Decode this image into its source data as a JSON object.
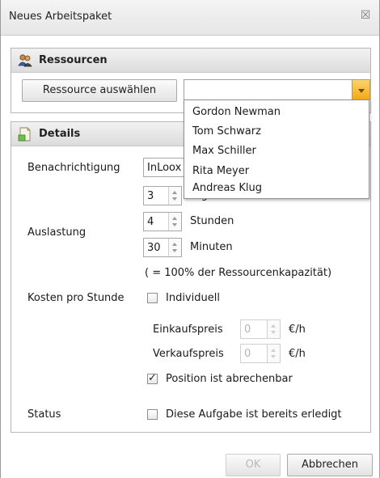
{
  "window": {
    "title": "Neues Arbeitspaket",
    "close_glyph": "☒"
  },
  "resources": {
    "heading": "Ressourcen",
    "select_button": "Ressource auswählen",
    "select_value": "",
    "dropdown_options": [
      "Gordon Newman",
      "Tom Schwarz",
      "Max Schiller",
      "Rita Meyer",
      "Andreas Klug"
    ]
  },
  "details": {
    "heading": "Details",
    "notification_label": "Benachrichtigung",
    "notification_value": "InLoox",
    "workload_label": "Auslastung",
    "days_value": "3",
    "days_unit": "Tage",
    "hours_value": "4",
    "hours_unit": "Stunden",
    "minutes_value": "30",
    "minutes_unit": "Minuten",
    "capacity_note": "( = 100% der Ressourcenkapazität)",
    "cost_label": "Kosten pro Stunde",
    "individual_label": "Individuell",
    "individual_checked": false,
    "purchase_label": "Einkaufspreis",
    "purchase_value": "0",
    "purchase_unit": "€/h",
    "sales_label": "Verkaufspreis",
    "sales_value": "0",
    "sales_unit": "€/h",
    "billable_label": "Position ist abrechenbar",
    "billable_checked": true,
    "status_label": "Status",
    "done_label": "Diese Aufgabe ist bereits erledigt",
    "done_checked": false
  },
  "footer": {
    "ok_label": "OK",
    "cancel_label": "Abbrechen"
  },
  "colors": {
    "accent_dropdown": "#f3a816",
    "disabled_text": "#b5b5b5"
  }
}
